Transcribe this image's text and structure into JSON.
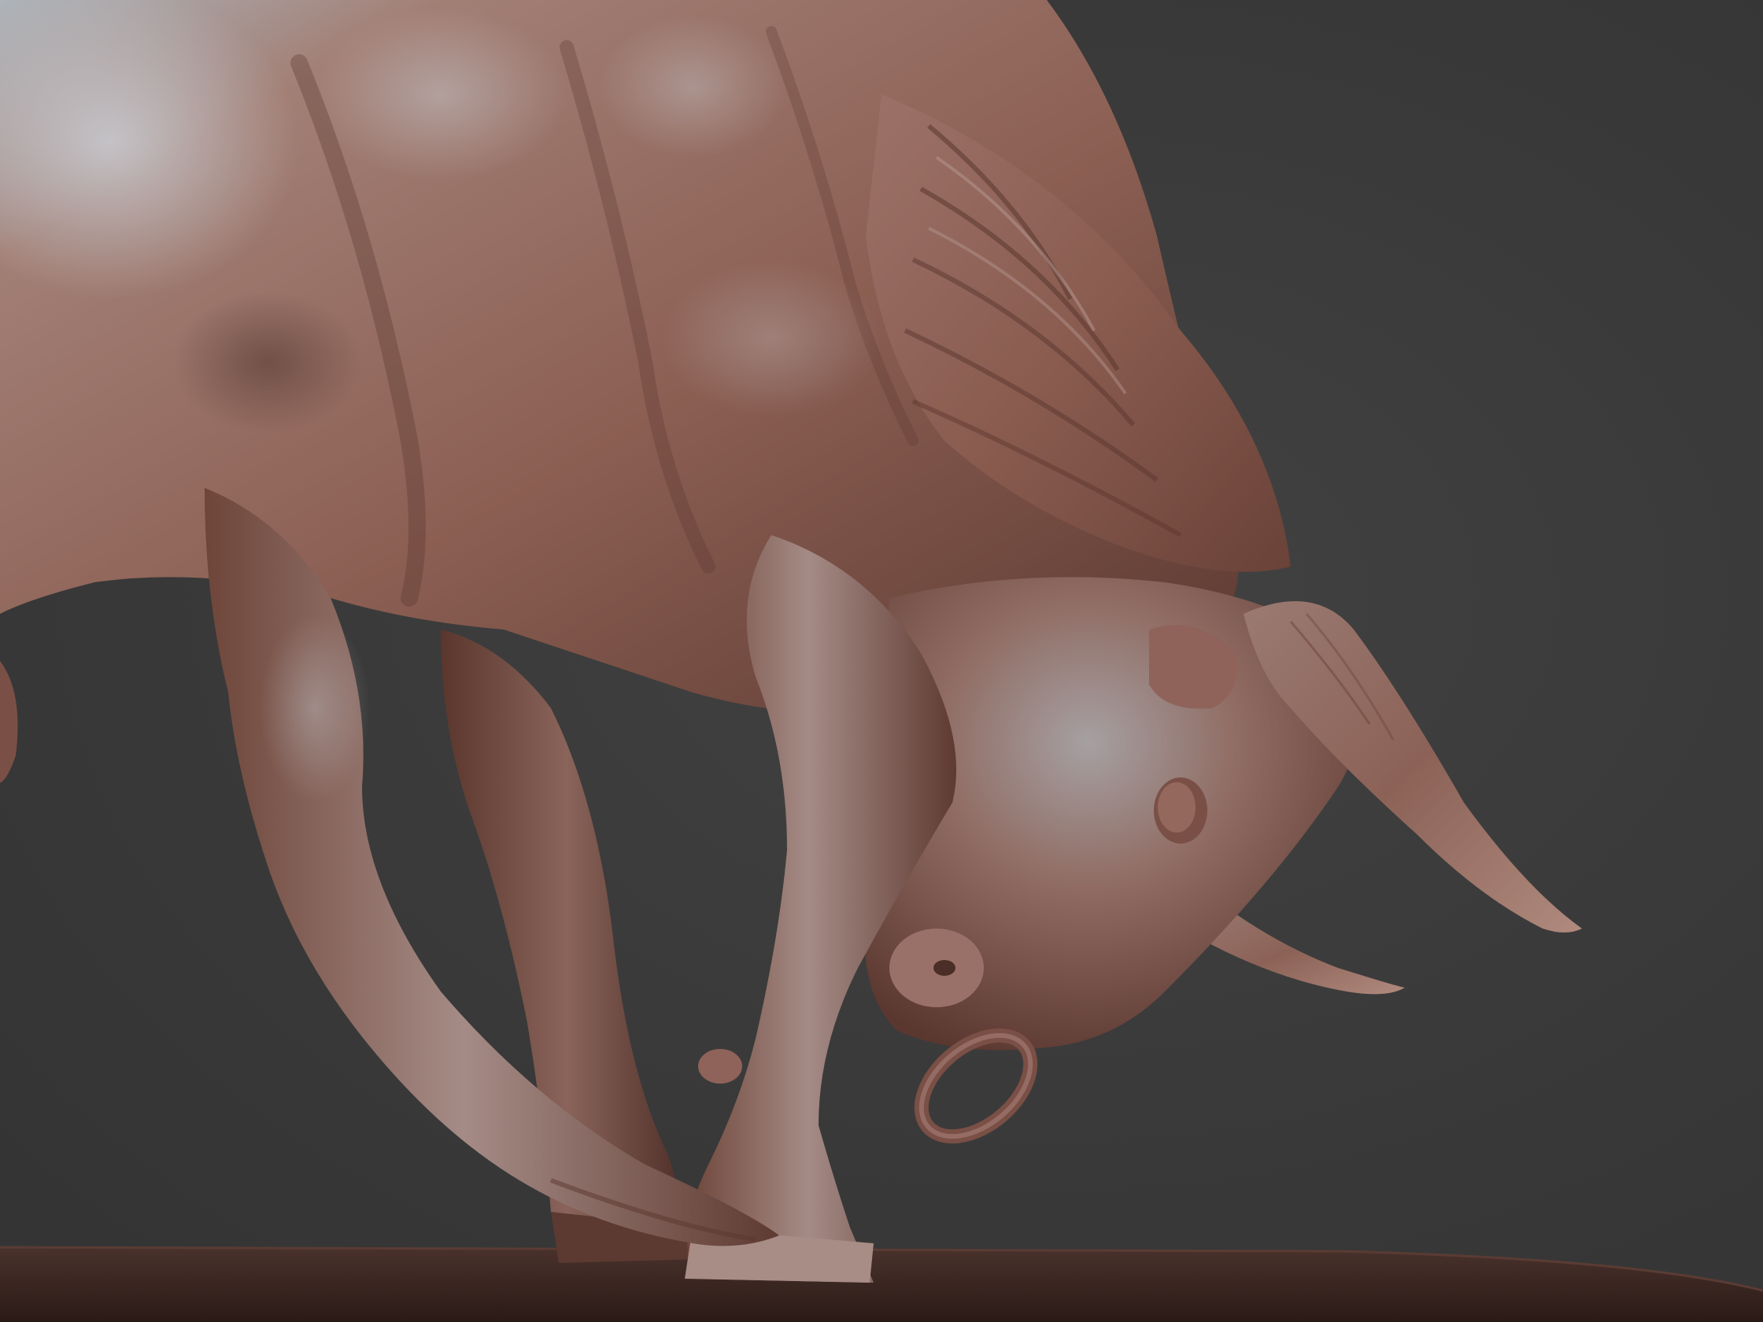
{
  "scene": {
    "subject": "sculpted-bull",
    "colors": {
      "background": "#3a3a3a",
      "clay_light": "#b08a7e",
      "clay_mid": "#8a5f53",
      "clay_dark": "#4a2e27",
      "clay_highlight": "#c6c9cf",
      "base": "#3a2622"
    }
  }
}
